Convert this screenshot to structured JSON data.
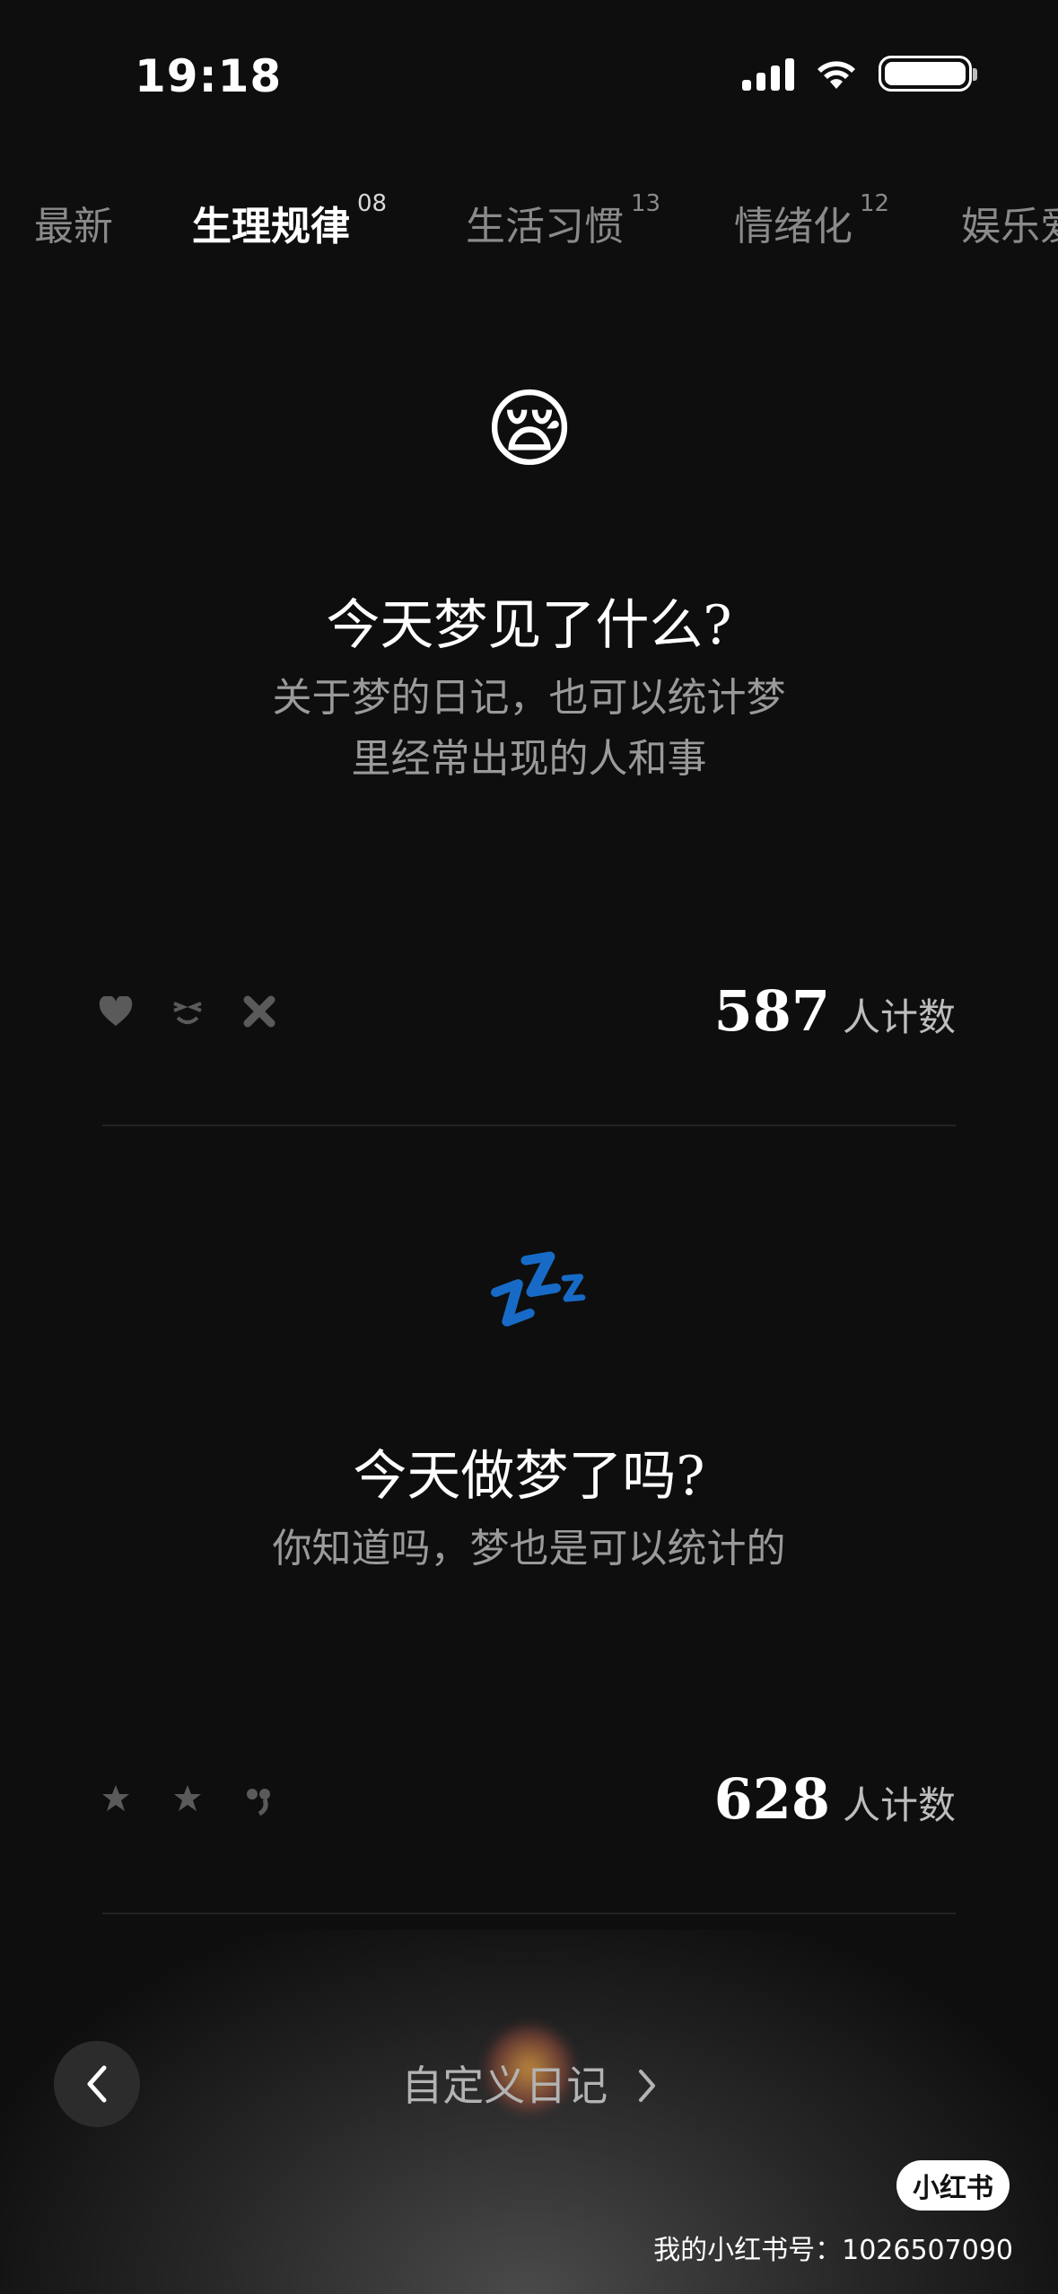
{
  "status_bar": {
    "time": "19:18"
  },
  "tabs": [
    {
      "label": "最新",
      "count": ""
    },
    {
      "label": "生理规律",
      "count": "08",
      "active": true
    },
    {
      "label": "生活习惯",
      "count": "13"
    },
    {
      "label": "情绪化",
      "count": "12"
    },
    {
      "label": "娱乐爱",
      "count": ""
    }
  ],
  "cards": [
    {
      "emoji": "😪",
      "title": "今天梦见了什么?",
      "subtitle_line1": "关于梦的日记，也可以统计梦",
      "subtitle_line2": "里经常出现的人和事",
      "reaction_icons": [
        "heart-icon",
        "squint-face-icon",
        "cross-icon"
      ],
      "count": "587",
      "count_label": "人计数"
    },
    {
      "emoji": "💤",
      "title": "今天做梦了吗?",
      "subtitle_line1": "你知道吗，梦也是可以统计的",
      "reaction_icons": [
        "star-badge-icon",
        "star-badge-icon",
        "comma-face-icon"
      ],
      "count": "628",
      "count_label": "人计数"
    }
  ],
  "footer": {
    "custom_diary_label": "自定义日记",
    "brand_label": "小红书",
    "account_text": "我的小红书号：1026507090"
  }
}
